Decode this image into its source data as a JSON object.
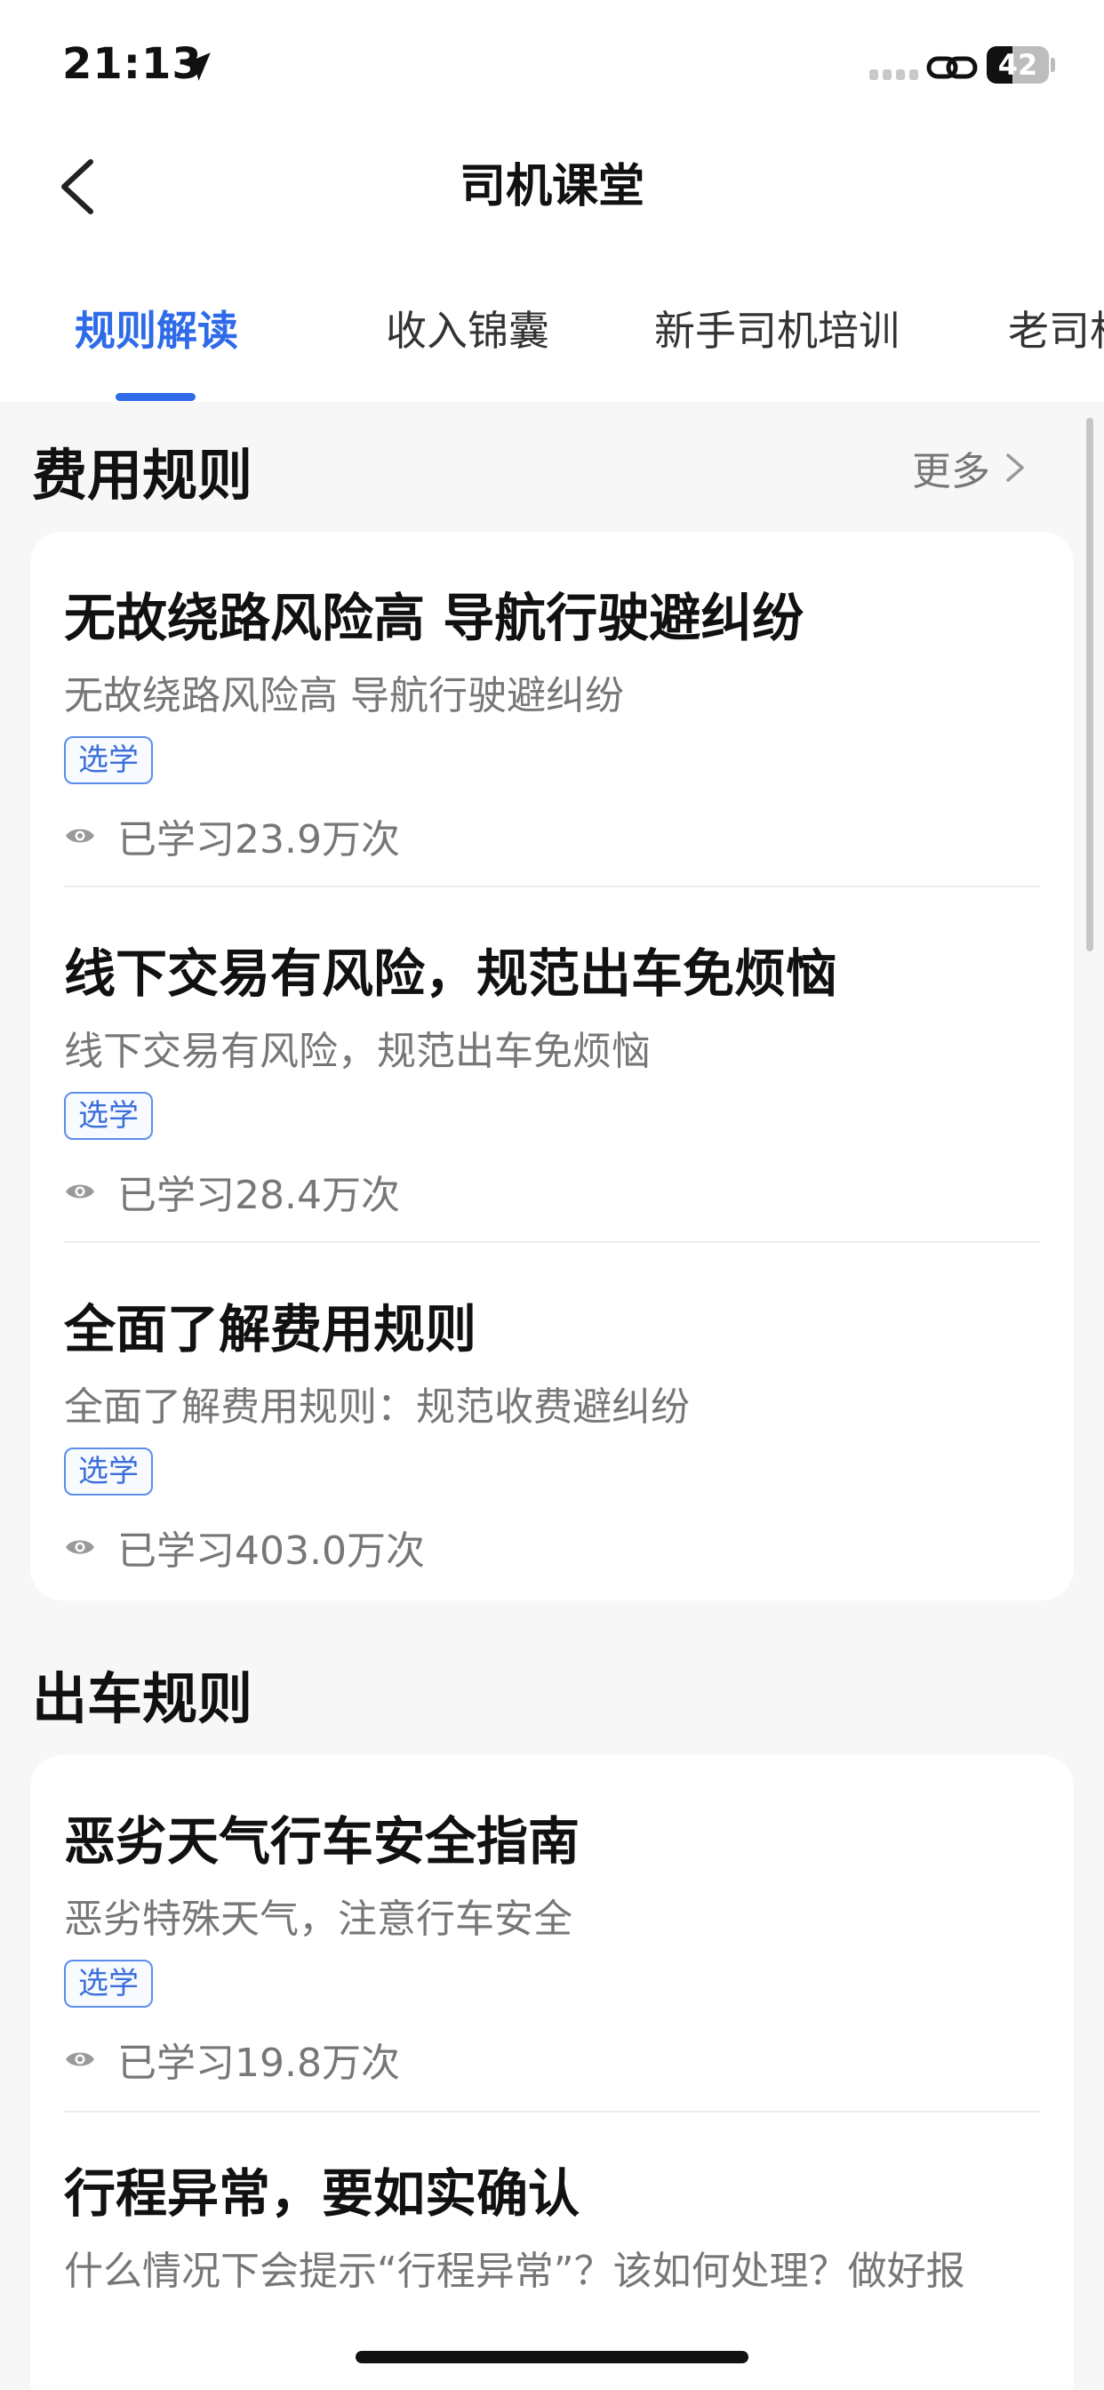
{
  "status_bar": {
    "time": "21:13",
    "battery": "42",
    "battery_level": 0.42
  },
  "header": {
    "title": "司机课堂"
  },
  "tabs": [
    {
      "label": "规则解读",
      "active": true
    },
    {
      "label": "收入锦囊",
      "active": false
    },
    {
      "label": "新手司机培训",
      "active": false
    },
    {
      "label": "老司机",
      "active": false
    }
  ],
  "colors": {
    "accent": "#2F6BE8",
    "background": "#F7F7F7",
    "card": "#FFFFFF"
  },
  "sections": [
    {
      "title": "费用规则",
      "more_label": "更多",
      "items": [
        {
          "title": "无故绕路风险高 导航行驶避纠纷",
          "desc": "无故绕路风险高 导航行驶避纠纷",
          "tag": "选学",
          "views": "已学习23.9万次"
        },
        {
          "title": "线下交易有风险，规范出车免烦恼",
          "desc": "线下交易有风险，规范出车免烦恼",
          "tag": "选学",
          "views": "已学习28.4万次"
        },
        {
          "title": "全面了解费用规则",
          "desc": "全面了解费用规则：规范收费避纠纷",
          "tag": "选学",
          "views": "已学习403.0万次"
        }
      ]
    },
    {
      "title": "出车规则",
      "items": [
        {
          "title": "恶劣天气行车安全指南",
          "desc": "恶劣特殊天气，注意行车安全",
          "tag": "选学",
          "views": "已学习19.8万次"
        },
        {
          "title": "行程异常，要如实确认",
          "desc": "什么情况下会提示“行程异常”？该如何处理？做好报"
        }
      ]
    }
  ]
}
